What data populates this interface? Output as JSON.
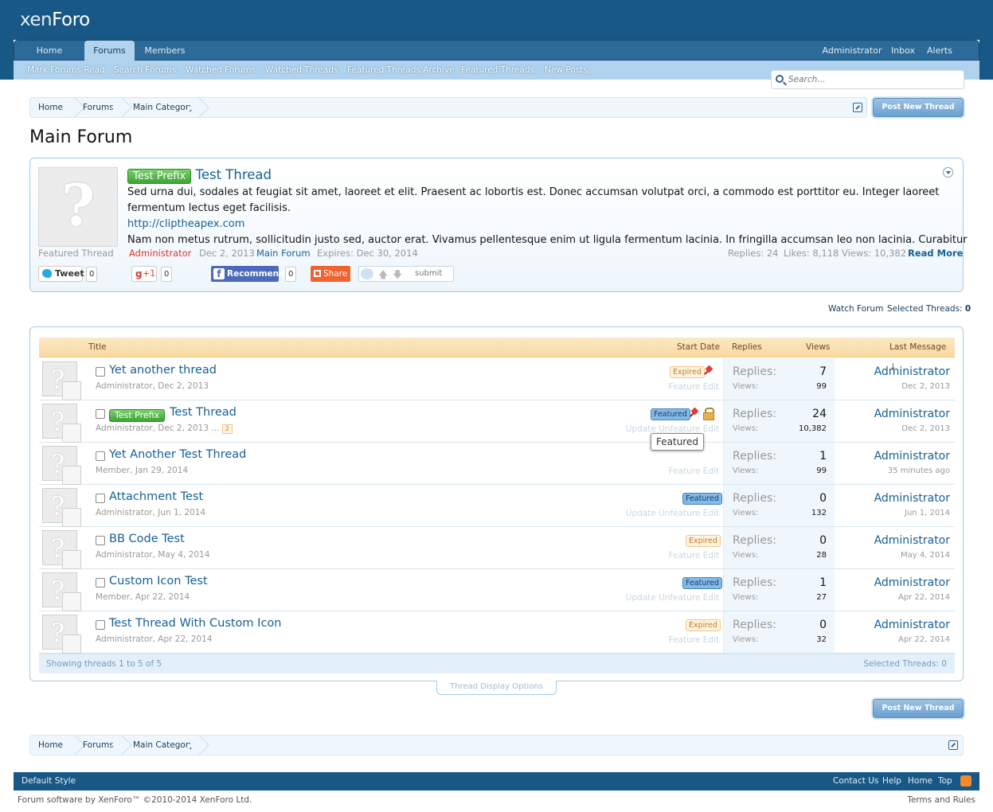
{
  "header": {
    "logo_part1": "xen",
    "logo_part2": "Foro"
  },
  "nav": {
    "tabs": [
      "Home",
      "Forums",
      "Members"
    ],
    "selected_tab": "Forums",
    "right_links": [
      "Administrator",
      "Inbox",
      "Alerts"
    ],
    "subnav": [
      "Mark Forums Read",
      "Search Forums",
      "Watched Forums",
      "Watched Threads",
      "Featured Threads Archive",
      "Featured Threads",
      "New Posts"
    ]
  },
  "search": {
    "placeholder": "Search..."
  },
  "breadcrumb": [
    "Home",
    "Forums",
    "Main Category"
  ],
  "post_new_thread_label": "Post New Thread",
  "page_title": "Main Forum",
  "featured": {
    "avatar_caption": "Featured Thread",
    "prefix": "Test Prefix",
    "title": "Test Thread",
    "body1": "Sed urna dui, sodales at feugiat sit amet, laoreet et elit. Praesent ac lobortis est. Donec accumsan volutpat orci, a commodo est porttitor eu. Integer laoreet",
    "body2": "fermentum lectus eget facilisis.",
    "link": "http://cliptheapex.com",
    "body3": "Nam non metus rutrum, sollicitudin justo sed, auctor erat. Vivamus pellentesque enim ut ligula fermentum lacinia. In fringilla accumsan leo non lacinia. Curabitur",
    "author": "Administrator",
    "date": "Dec 2, 2013",
    "forum": "Main Forum",
    "expires": "Expires: Dec 30, 2014",
    "replies": "Replies: 24",
    "likes": "Likes: 8,118",
    "views": "Views: 10,382",
    "read_more": "Read More",
    "social": {
      "tweet": "Tweet",
      "tweet_count": "0",
      "gplus": "+1",
      "gplus_count": "0",
      "recommend": "Recommend",
      "recommend_count": "0",
      "share": "Share",
      "submit": "submit"
    }
  },
  "top_links": {
    "watch_forum": "Watch Forum",
    "selected_label": "Selected Threads:",
    "selected_count": "0"
  },
  "table_headers": {
    "title": "Title",
    "start_date": "Start Date",
    "replies": "Replies",
    "views": "Views",
    "last_message": "Last Message ↓"
  },
  "threads": [
    {
      "title": "Yet another thread",
      "author": "Administrator",
      "date": "Dec 2, 2013",
      "flag": "Expired",
      "flag_type": "exp",
      "controls": "Feature Edit",
      "pinned": true,
      "locked": false,
      "replies": "7",
      "views": "99",
      "last_poster": "Administrator",
      "last_date": "Dec 2, 2013"
    },
    {
      "title": "Test Thread",
      "prefix": "Test Prefix",
      "author": "Administrator",
      "date": "Dec 2, 2013",
      "pages": "2",
      "flag": "Featured",
      "flag_type": "feat",
      "controls": "Update Unfeature Edit",
      "pinned": true,
      "locked": true,
      "replies": "24",
      "views": "10,382",
      "last_poster": "Administrator",
      "last_date": "Dec 2, 2013"
    },
    {
      "title": "Yet Another Test Thread",
      "author": "Member",
      "date": "Jan 29, 2014",
      "flag": "",
      "flag_type": "",
      "controls": "Feature Edit",
      "pinned": false,
      "locked": false,
      "replies": "1",
      "views": "99",
      "last_poster": "Administrator",
      "last_date": "35 minutes ago"
    },
    {
      "title": "Attachment Test",
      "author": "Administrator",
      "date": "Jun 1, 2014",
      "flag": "Featured",
      "flag_type": "feat",
      "controls": "Update Unfeature Edit",
      "pinned": false,
      "locked": false,
      "replies": "0",
      "views": "132",
      "last_poster": "Administrator",
      "last_date": "Jun 1, 2014"
    },
    {
      "title": "BB Code Test",
      "author": "Administrator",
      "date": "May 4, 2014",
      "flag": "Expired",
      "flag_type": "exp",
      "controls": "Feature Edit",
      "pinned": false,
      "locked": false,
      "replies": "0",
      "views": "28",
      "last_poster": "Administrator",
      "last_date": "May 4, 2014"
    },
    {
      "title": "Custom Icon Test",
      "author": "Member",
      "date": "Apr 22, 2014",
      "flag": "Featured",
      "flag_type": "feat",
      "controls": "Update Unfeature Edit",
      "pinned": false,
      "locked": false,
      "replies": "1",
      "views": "27",
      "last_poster": "Administrator",
      "last_date": "Apr 22, 2014"
    },
    {
      "title": "Test Thread With Custom Icon",
      "author": "Administrator",
      "date": "Apr 22, 2014",
      "flag": "Expired",
      "flag_type": "exp",
      "controls": "Feature Edit",
      "pinned": false,
      "locked": false,
      "replies": "0",
      "views": "32",
      "last_poster": "Administrator",
      "last_date": "Apr 22, 2014"
    }
  ],
  "stat_labels": {
    "replies": "Replies:",
    "views": "Views:"
  },
  "tooltip": "Featured",
  "list_footer": {
    "showing": "Showing threads 1 to 5 of 5",
    "selected": "Selected Threads: 0"
  },
  "thread_display_options": "Thread Display Options",
  "footer": {
    "style": "Default Style",
    "links": [
      "Contact Us",
      "Help",
      "Home",
      "Top"
    ],
    "copyright": "Forum software by XenForo™ ©2010-2014 XenForo Ltd.",
    "terms": "Terms and Rules"
  }
}
